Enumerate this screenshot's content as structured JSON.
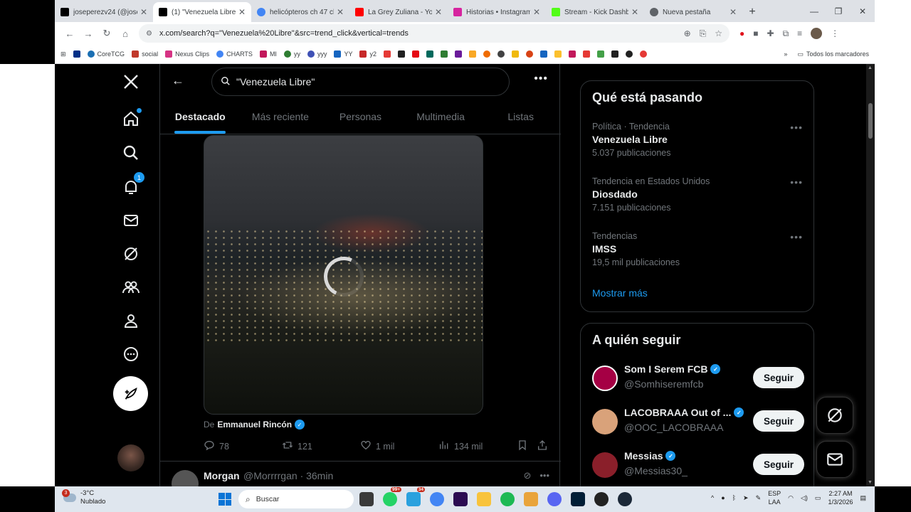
{
  "browser": {
    "tabs": [
      {
        "title": "joseperezv24 (@josep",
        "color": "#000000",
        "active": false
      },
      {
        "title": "(1) \"Venezuela Libre\"",
        "color": "#000000",
        "active": true
      },
      {
        "title": "helicópteros ch 47 ch",
        "color": "#4285f4",
        "active": false
      },
      {
        "title": "La Grey Zuliana - You",
        "color": "#ff0000",
        "active": false
      },
      {
        "title": "Historias • Instagram",
        "color": "#d6249f",
        "active": false
      },
      {
        "title": "Stream - Kick Dashbo",
        "color": "#53fc18",
        "active": false
      },
      {
        "title": "Nueva pestaña",
        "color": "#5f6368",
        "active": false
      }
    ],
    "url": "x.com/search?q=\"Venezuela%20Libre\"&src=trend_click&vertical=trends",
    "bookmarks": [
      "CoreTCG",
      "social",
      "Nexus Clips",
      "CHARTS",
      "MI",
      "yy",
      "yyy",
      "YY",
      "y2"
    ],
    "all_bookmarks_label": "Todos los marcadores"
  },
  "nav": {
    "notifications_badge": "1"
  },
  "search": {
    "query": "\"Venezuela Libre\"",
    "tabs": [
      "Destacado",
      "Más reciente",
      "Personas",
      "Multimedia",
      "Listas"
    ]
  },
  "post": {
    "from_label": "De",
    "author": "Emmanuel Rincón",
    "replies": "78",
    "reposts": "121",
    "likes": "1 mil",
    "views": "134 mil"
  },
  "next_post": {
    "name": "Morgan",
    "handle": "@Morrrrgan",
    "time": "· 36min"
  },
  "trends": {
    "title": "Qué está pasando",
    "items": [
      {
        "category": "Política · Tendencia",
        "name": "Venezuela Libre",
        "count": "5.037 publicaciones"
      },
      {
        "category": "Tendencia en Estados Unidos",
        "name": "Diosdado",
        "count": "7.151 publicaciones"
      },
      {
        "category": "Tendencias",
        "name": "IMSS",
        "count": "19,5 mil publicaciones"
      }
    ],
    "show_more": "Mostrar más"
  },
  "who_to_follow": {
    "title": "A quién seguir",
    "follow_label": "Seguir",
    "users": [
      {
        "name": "Som I Serem FCB",
        "handle": "@Somhiseremfcb",
        "avatar_color": "#a50044"
      },
      {
        "name": "LACOBRAAA Out of ...",
        "handle": "@OOC_LACOBRAAA",
        "avatar_color": "#d9a27a"
      },
      {
        "name": "Messias",
        "handle": "@Messias30_",
        "avatar_color": "#8a1f2a"
      }
    ]
  },
  "taskbar": {
    "weather_badge": "3",
    "temperature": "-3°C",
    "condition": "Nublado",
    "search_label": "Buscar",
    "whatsapp_badge": "99+",
    "app_badge": "34",
    "lang_top": "ESP",
    "lang_bottom": "LAA",
    "time": "2:27 AM",
    "date": "1/3/2026"
  }
}
